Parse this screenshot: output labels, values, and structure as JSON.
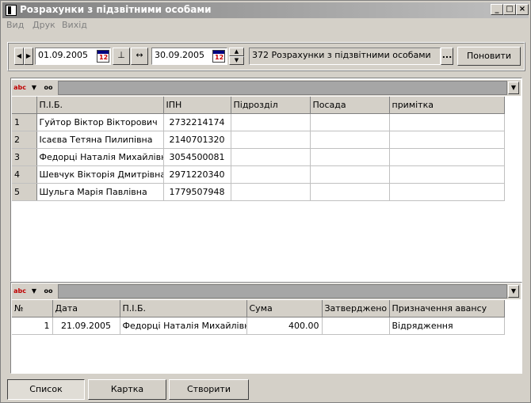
{
  "window": {
    "title": "Розрахунки з підзвітними особами",
    "buttons": {
      "minimize": "_",
      "maximize": "□",
      "close": "×"
    }
  },
  "menu": [
    "Вид",
    "Друк",
    "Вихід"
  ],
  "toolbar": {
    "date_from": "01.09.2005",
    "date_to": "30.09.2005",
    "account": "372 Розрахунки з підзвітними особами",
    "browse_label": "...",
    "refresh_label": "Поновити",
    "cal_label": "12"
  },
  "grid_icons": {
    "abc": "abc",
    "filter": "▼",
    "glasses": "oo",
    "drop": "▼"
  },
  "persons": {
    "columns": [
      "П.І.Б.",
      "ІПН",
      "Підрозділ",
      "Посада",
      "примітка"
    ],
    "rows": [
      {
        "n": "1",
        "name": "Гуйтор Віктор Вікторович",
        "ipn": "2732214174",
        "dept": "",
        "pos": "",
        "note": ""
      },
      {
        "n": "2",
        "name": "Ісаєва Тетяна Пилипівна",
        "ipn": "2140701320",
        "dept": "",
        "pos": "",
        "note": ""
      },
      {
        "n": "3",
        "name": "Федорці Наталія Михайлівна",
        "ipn": "3054500081",
        "dept": "",
        "pos": "",
        "note": ""
      },
      {
        "n": "4",
        "name": "Шевчук Вікторія Дмитрівна",
        "ipn": "2971220340",
        "dept": "",
        "pos": "",
        "note": ""
      },
      {
        "n": "5",
        "name": "Шульга Марія Павлівна",
        "ipn": "1779507948",
        "dept": "",
        "pos": "",
        "note": ""
      }
    ]
  },
  "advances": {
    "columns": [
      "№",
      "Дата",
      "П.І.Б.",
      "Сума",
      "Затверджено",
      "Призначення авансу"
    ],
    "rows": [
      {
        "n": "1",
        "date": "21.09.2005",
        "name": "Федорці Наталія Михайлівна",
        "sum": "400.00",
        "approved": "",
        "purpose": "Відрядження"
      }
    ]
  },
  "bottom_buttons": {
    "list": "Список",
    "card": "Картка",
    "create": "Створити"
  }
}
